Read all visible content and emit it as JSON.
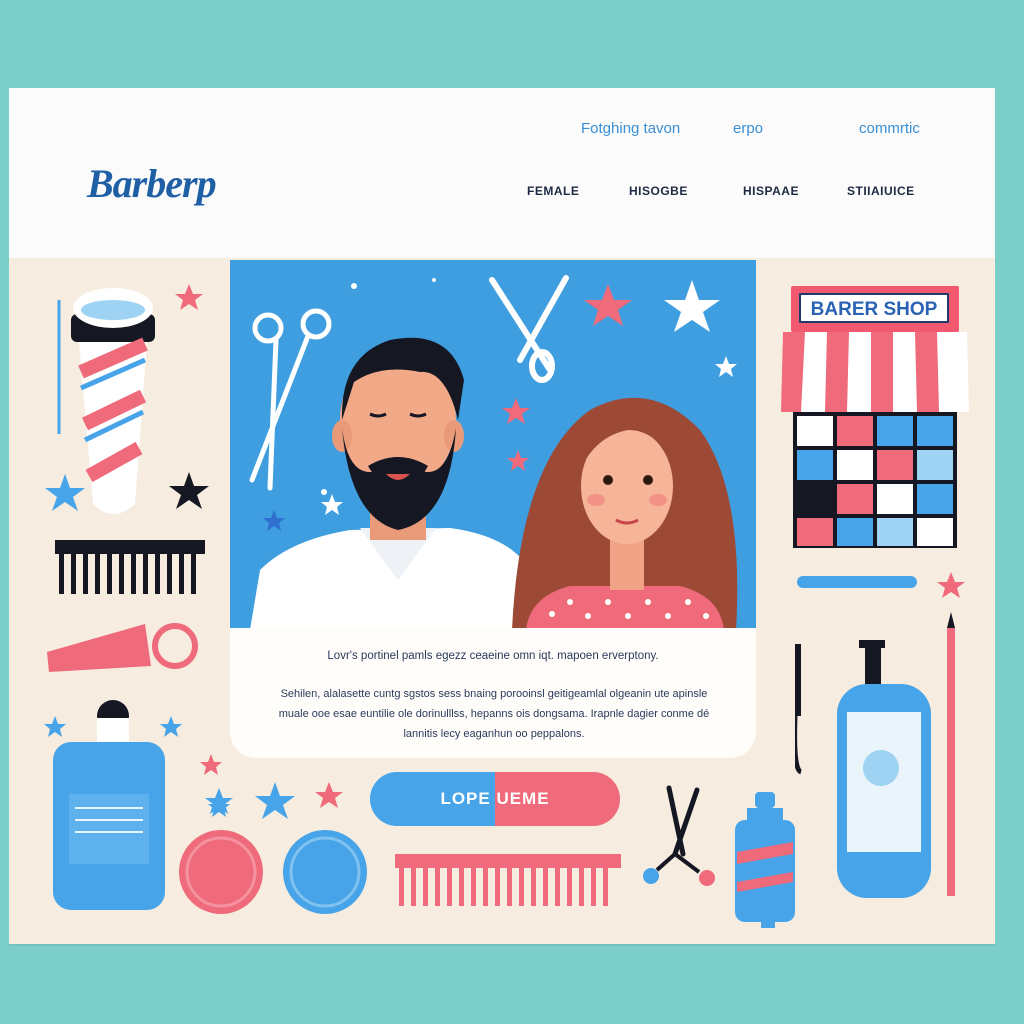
{
  "header": {
    "logo": "Barberp",
    "top_links": [
      "Fotghing tavon",
      "erpo",
      "commrtic"
    ],
    "nav": [
      "FEMALE",
      "HISOGBE",
      "HISPAAE",
      "STIIAIUICE"
    ]
  },
  "hero_card": {
    "title": "Lovr's portinel pamls egezz ceaeine omn iqt. mapoen erverptony.",
    "body": "Sehilen, alalasette cuntg sgstos sess bnaing porooinsl geitigeamlal olgeanin ute apinsle muale ooe esae euntilie ole dorinulllss, hepanns ois dongsama. Irapnle dagier conme dé lannitis lecy eaganhun oo peppalons."
  },
  "cta": {
    "label": "LOPE UEME"
  },
  "shop_sign": {
    "label": "BARER SHOP"
  },
  "colors": {
    "background": "#7ccfc9",
    "accent_blue": "#3f9ee0",
    "accent_pink": "#ef6a7a",
    "navy": "#1e2a44"
  }
}
